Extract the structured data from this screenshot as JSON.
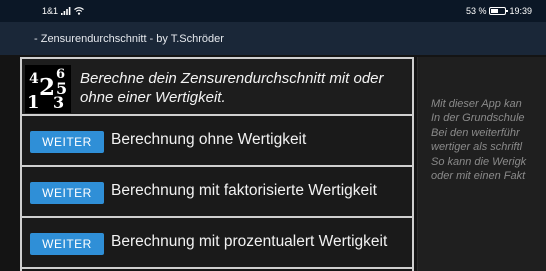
{
  "status_bar": {
    "carrier": "1&1",
    "battery_percent": "53 %",
    "battery_level": 0.53,
    "time": "19:39",
    "icons": [
      "signal-icon",
      "wifi-icon",
      "battery-icon"
    ]
  },
  "app": {
    "title": "- Zensurendurchschnitt - by T.Schröder"
  },
  "header": {
    "logo_digits": [
      "4",
      "6",
      "2",
      "5",
      "1",
      "3"
    ],
    "text": "Berechne dein Zensurendurchschnitt mit oder ohne einer Wertigkeit."
  },
  "options": [
    {
      "button": "WEITER",
      "label": "Berechnung ohne Wertigkeit"
    },
    {
      "button": "WEITER",
      "label": "Berechnung mit faktorisierte Wertigkeit"
    },
    {
      "button": "WEITER",
      "label": "Berechnung mit prozentualert Wertigkeit"
    }
  ],
  "info": {
    "lines": [
      "Mit dieser App kan",
      "In der Grundschule",
      "Bei den weiterführ",
      "wertiger als schriftl",
      "So kann die Werigk",
      "oder mit einen Fakt"
    ]
  },
  "colors": {
    "status_bar": "#0b1726",
    "title_bar": "#1a2738",
    "button": "#2f8fd7",
    "border": "#cfcfcf"
  }
}
